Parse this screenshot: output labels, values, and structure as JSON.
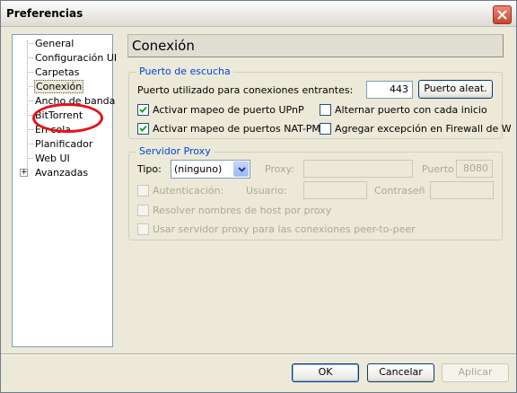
{
  "window": {
    "title": "Preferencias"
  },
  "sidebar": {
    "items": [
      {
        "label": "General"
      },
      {
        "label": "Configuración UI"
      },
      {
        "label": "Carpetas"
      },
      {
        "label": "Conexión"
      },
      {
        "label": "Ancho de banda"
      },
      {
        "label": "BitTorrent"
      },
      {
        "label": "En cola"
      },
      {
        "label": "Planificador"
      },
      {
        "label": "Web UI"
      },
      {
        "label": "Avanzadas"
      }
    ],
    "selected": "Conexión",
    "expander": "+"
  },
  "main": {
    "section_title": "Conexión",
    "listen_port": {
      "group_title": "Puerto de escucha",
      "port_label": "Puerto utilizado para conexiones entrantes:",
      "port_value": "443",
      "random_button": "Puerto aleat.",
      "upnp_label": "Activar mapeo de puerto UPnP",
      "upnp_checked": true,
      "natpmp_label": "Activar mapeo de puertos NAT-PMP",
      "natpmp_checked": true,
      "alternate_label": "Alternar puerto con cada inicio",
      "alternate_checked": false,
      "firewall_label": "Agregar excepción en Firewall de W",
      "firewall_checked": false
    },
    "proxy": {
      "group_title": "Servidor Proxy",
      "type_label": "Tipo:",
      "type_value": "(ninguno)",
      "proxy_label": "Proxy:",
      "port_label": "Puerto",
      "port_value": "8080",
      "auth_label": "Autenticación:",
      "user_label": "Usuario:",
      "password_label": "Contraseña",
      "resolve_label": "Resolver nombres de host por proxy",
      "peer_label": "Usar servidor proxy para las conexiones peer-to-peer"
    }
  },
  "footer": {
    "ok": "OK",
    "cancel": "Cancelar",
    "apply": "Aplicar"
  },
  "colors": {
    "annotation_oval": "#e8101a",
    "group_title": "#0046d5"
  }
}
